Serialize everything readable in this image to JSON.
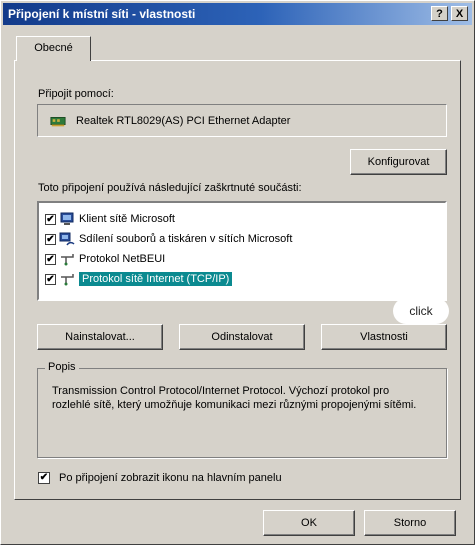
{
  "window": {
    "title": "Připojení k místní síti - vlastnosti",
    "help_btn": "?",
    "close_btn": "X"
  },
  "tabs": [
    {
      "label": "Obecné"
    }
  ],
  "connect_using": {
    "label": "Připojit pomocí:",
    "adapter": "Realtek RTL8029(AS) PCI Ethernet Adapter",
    "configure_button": "Konfigurovat"
  },
  "components": {
    "label": "Toto připojení používá následující zaškrtnuté součásti:",
    "items": [
      {
        "label": "Klient sítě Microsoft",
        "checked": true,
        "icon": "network-client-icon"
      },
      {
        "label": "Sdílení souborů a tiskáren v sítích Microsoft",
        "checked": true,
        "icon": "file-print-sharing-icon"
      },
      {
        "label": "Protokol NetBEUI",
        "checked": true,
        "icon": "protocol-icon"
      },
      {
        "label": "Protokol sítě Internet (TCP/IP)",
        "checked": true,
        "icon": "protocol-icon",
        "selected": true
      }
    ],
    "check_mark": "✔"
  },
  "buttons": {
    "install": "Nainstalovat...",
    "uninstall": "Odinstalovat",
    "properties": "Vlastnosti"
  },
  "callout": "click",
  "description": {
    "title": "Popis",
    "text": "Transmission Control Protocol/Internet Protocol. Výchozí protokol pro rozlehlé sítě, který umožňuje komunikaci mezi různými propojenými sítěmi."
  },
  "show_icon": {
    "label": "Po připojení zobrazit ikonu na hlavním panelu",
    "checked": true,
    "mark": "✔"
  },
  "footer": {
    "ok": "OK",
    "cancel": "Storno"
  },
  "colors": {
    "title_gradient_start": "#123a8a",
    "title_gradient_end": "#9fbde6",
    "selection": "#0b8a90"
  }
}
